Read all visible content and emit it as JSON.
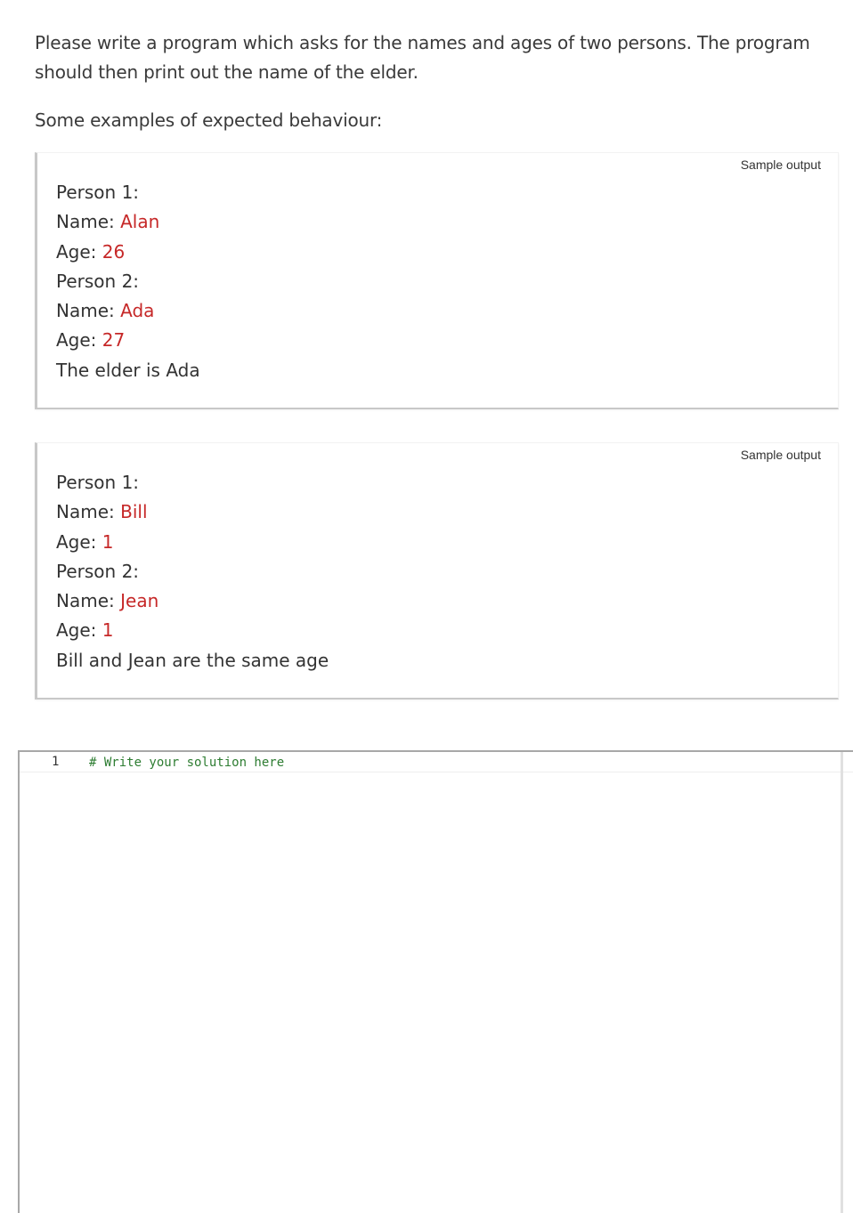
{
  "intro": {
    "paragraph": "Please write a program which asks for the names and ages of two persons. The program should then print out the name of the elder.",
    "examples_heading": "Some examples of expected behaviour:"
  },
  "samples": [
    {
      "label": "Sample output",
      "lines": [
        {
          "prompt": "Person 1:",
          "input": ""
        },
        {
          "prompt": "Name: ",
          "input": "Alan"
        },
        {
          "prompt": "Age: ",
          "input": "26"
        },
        {
          "prompt": "Person 2:",
          "input": ""
        },
        {
          "prompt": "Name: ",
          "input": "Ada"
        },
        {
          "prompt": "Age: ",
          "input": "27"
        },
        {
          "prompt": "The elder is Ada",
          "input": ""
        }
      ]
    },
    {
      "label": "Sample output",
      "lines": [
        {
          "prompt": "Person 1:",
          "input": ""
        },
        {
          "prompt": "Name: ",
          "input": "Bill"
        },
        {
          "prompt": "Age: ",
          "input": "1"
        },
        {
          "prompt": "Person 2:",
          "input": ""
        },
        {
          "prompt": "Name: ",
          "input": "Jean"
        },
        {
          "prompt": "Age: ",
          "input": "1"
        },
        {
          "prompt": "Bill and Jean are the same age",
          "input": ""
        }
      ]
    }
  ],
  "editor": {
    "line_number": "1",
    "code": "# Write your solution here"
  },
  "colors": {
    "user_input": "#c62828",
    "comment": "#2e7d32"
  }
}
